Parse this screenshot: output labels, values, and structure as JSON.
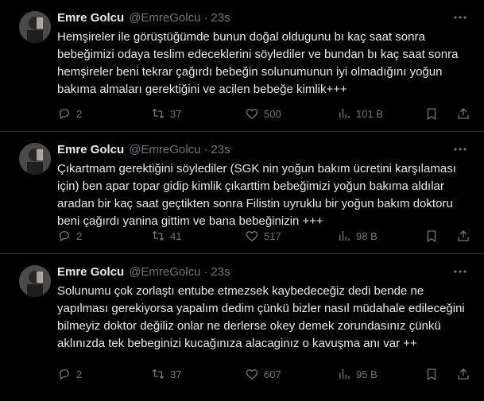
{
  "tweets": [
    {
      "name": "Emre Golcu",
      "handle": "@EmreGolcu",
      "dot": "·",
      "time": "23s",
      "text": "Hemşireler ile görüştüğümde bunun doğal oldugunu bı kaç saat sonra bebeğimizi odaya teslim edeceklerini söylediler ve bundan bı kaç saat sonra hemşireler beni tekrar çağırdı bebeğin solunumunun iyi olmadığını yoğun bakıma almaları gerektiğini ve acilen bebeğe kimlik+++",
      "replies": "2",
      "retweets": "37",
      "likes": "500",
      "views": "101 B"
    },
    {
      "name": "Emre Golcu",
      "handle": "@EmreGolcu",
      "dot": "·",
      "time": "23s",
      "text": "Çıkartmam gerektiğini söylediler (SGK nin yoğun bakım ücretini karşılaması için) ben apar topar gidip kimlik çıkarttim bebeğimizi yoğun bakıma aldılar aradan bir kaç saat geçtikten sonra Filistin uyruklu bir yoğun bakım doktoru beni çağırdı yanina gittim ve bana bebeğinizin +++",
      "replies": "2",
      "retweets": "41",
      "likes": "517",
      "views": "98 B"
    },
    {
      "name": "Emre Golcu",
      "handle": "@EmreGolcu",
      "dot": "·",
      "time": "23s",
      "text": "Solunumu çok zorlaştı entube etmezsek kaybedeceğiz dedi bende ne yapılması gerekiyorsa yapalım dedim çünkü bizler nasıl müdahale edileceğini bilmeyiz doktor değiliz onlar ne derlerse okey demek zorundasınız çünkü aklınızda tek bebeginizi kucağınıza alacaginız o kavuşma anı var ++",
      "replies": "2",
      "retweets": "37",
      "likes": "607",
      "views": "95 B"
    }
  ],
  "icons": {
    "more": "more-icon",
    "reply": "reply-icon",
    "retweet": "retweet-icon",
    "like": "heart-icon",
    "views": "views-icon",
    "bookmark": "bookmark-icon",
    "share": "share-icon"
  }
}
